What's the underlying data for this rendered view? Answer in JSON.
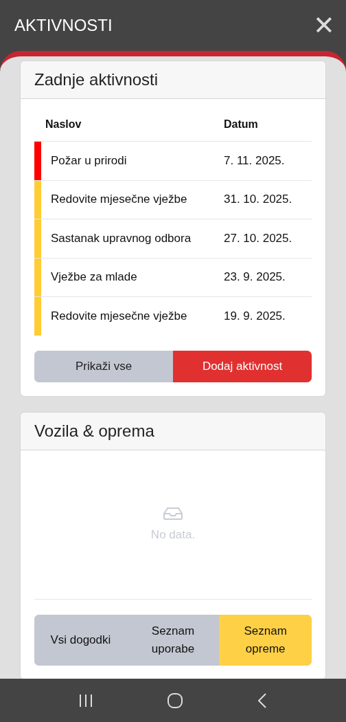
{
  "header": {
    "title": "AKTIVNOSTI",
    "close_icon": "✕"
  },
  "activities": {
    "title": "Zadnje aktivnosti",
    "columns": [
      "Naslov",
      "Datum"
    ],
    "rows": [
      {
        "title": "Požar u prirodi",
        "date": "7. 11. 2025.",
        "color": "#ff0000"
      },
      {
        "title": "Redovite mjesečne vježbe",
        "date": "31. 10. 2025.",
        "color": "#ffcc33"
      },
      {
        "title": "Sastanak upravnog odbora",
        "date": "27. 10. 2025.",
        "color": "#ffcc33"
      },
      {
        "title": "Vježbe za mlade",
        "date": "23. 9. 2025.",
        "color": "#ffcc33"
      },
      {
        "title": "Redovite mjesečne vježbe",
        "date": "19. 9. 2025.",
        "color": "#ffcc33"
      }
    ],
    "buttons": [
      {
        "label": "Prikaži vse",
        "kind": "secondary"
      },
      {
        "label": "Dodaj aktivnost",
        "kind": "primary"
      }
    ]
  },
  "equipment": {
    "title": "Vozila & oprema",
    "empty_text": "No data.",
    "tabs": [
      {
        "label": "Vsi dogodki",
        "selected": false
      },
      {
        "label": "Seznam uporabe",
        "selected": false
      },
      {
        "label": "Seznam opreme",
        "selected": true
      }
    ]
  }
}
